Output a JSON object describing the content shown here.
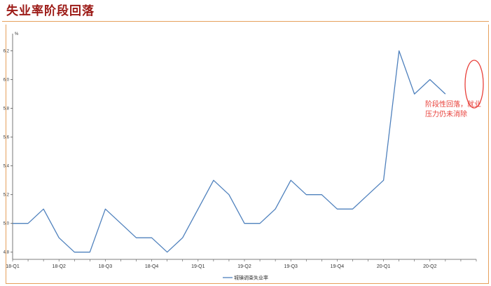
{
  "header": {
    "title": "失业率阶段回落"
  },
  "chart_data": {
    "type": "line",
    "unit": "%",
    "categories": [
      "18-Q1",
      "18-Q2",
      "18-Q3",
      "18-Q4",
      "19-Q1",
      "19-Q2",
      "19-Q3",
      "19-Q4",
      "20-Q1",
      "20-Q2"
    ],
    "x": [
      "2018-01",
      "2018-02",
      "2018-03",
      "2018-04",
      "2018-05",
      "2018-06",
      "2018-07",
      "2018-08",
      "2018-09",
      "2018-10",
      "2018-11",
      "2018-12",
      "2019-01",
      "2019-02",
      "2019-03",
      "2019-04",
      "2019-05",
      "2019-06",
      "2019-07",
      "2019-08",
      "2019-09",
      "2019-10",
      "2019-11",
      "2019-12",
      "2020-01",
      "2020-02",
      "2020-03",
      "2020-04",
      "2020-05",
      "2020-06",
      "2020-07"
    ],
    "series": [
      {
        "name": "城镇调查失业率",
        "color": "#4f81bd",
        "values": [
          5.0,
          5.0,
          5.1,
          4.9,
          4.8,
          4.8,
          5.1,
          5.0,
          4.9,
          4.9,
          4.8,
          4.9,
          5.1,
          5.3,
          5.2,
          5.0,
          5.0,
          5.1,
          5.3,
          5.2,
          5.2,
          5.1,
          5.1,
          5.2,
          5.3,
          6.2,
          5.9,
          6.0,
          5.9
        ]
      }
    ],
    "yticks": [
      "4.8",
      "5.0",
      "5.2",
      "5.4",
      "5.6",
      "5.8",
      "6.0",
      "6.2"
    ],
    "ylim": [
      4.75,
      6.3
    ],
    "grid": false,
    "legend": "bottom",
    "annotation": {
      "line1": "阶段性回落，就业",
      "line2": "压力仍未消除",
      "color": "#e8403a"
    }
  }
}
